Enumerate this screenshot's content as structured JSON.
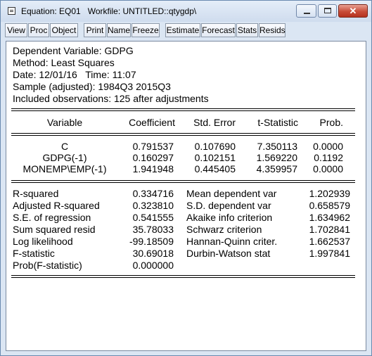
{
  "window": {
    "title": "Equation: EQ01   Workfile: UNTITLED::qtygdp\\"
  },
  "toolbar": {
    "buttons": [
      "View",
      "Proc",
      "Object",
      "Print",
      "Name",
      "Freeze",
      "Estimate",
      "Forecast",
      "Stats",
      "Resids"
    ]
  },
  "header": {
    "dependent": "Dependent Variable: GDPG",
    "method": "Method: Least Squares",
    "datetime": "Date: 12/01/16   Time: 11:07",
    "sample": "Sample (adjusted): 1984Q3 2015Q3",
    "observations": "Included observations: 125 after adjustments"
  },
  "coef_table": {
    "columns": [
      "Variable",
      "Coefficient",
      "Std. Error",
      "t-Statistic",
      "Prob."
    ],
    "rows": [
      [
        "C",
        "0.791537",
        "0.107690",
        "7.350113",
        "0.0000"
      ],
      [
        "GDPG(-1)",
        "0.160297",
        "0.102151",
        "1.569220",
        "0.1192"
      ],
      [
        "MONEMP\\EMP(-1)",
        "1.941948",
        "0.445405",
        "4.359957",
        "0.0000"
      ]
    ]
  },
  "stats": {
    "left": [
      [
        "R-squared",
        "0.334716"
      ],
      [
        "Adjusted R-squared",
        "0.323810"
      ],
      [
        "S.E. of regression",
        "0.541555"
      ],
      [
        "Sum squared resid",
        "35.78033"
      ],
      [
        "Log likelihood",
        "-99.18509"
      ],
      [
        "F-statistic",
        "30.69018"
      ],
      [
        "Prob(F-statistic)",
        "0.000000"
      ]
    ],
    "right": [
      [
        "Mean dependent var",
        "1.202939"
      ],
      [
        "S.D. dependent var",
        "0.658579"
      ],
      [
        "Akaike info criterion",
        "1.634962"
      ],
      [
        "Schwarz criterion",
        "1.702841"
      ],
      [
        "Hannan-Quinn criter.",
        "1.662537"
      ],
      [
        "Durbin-Watson stat",
        "1.997841"
      ]
    ]
  }
}
